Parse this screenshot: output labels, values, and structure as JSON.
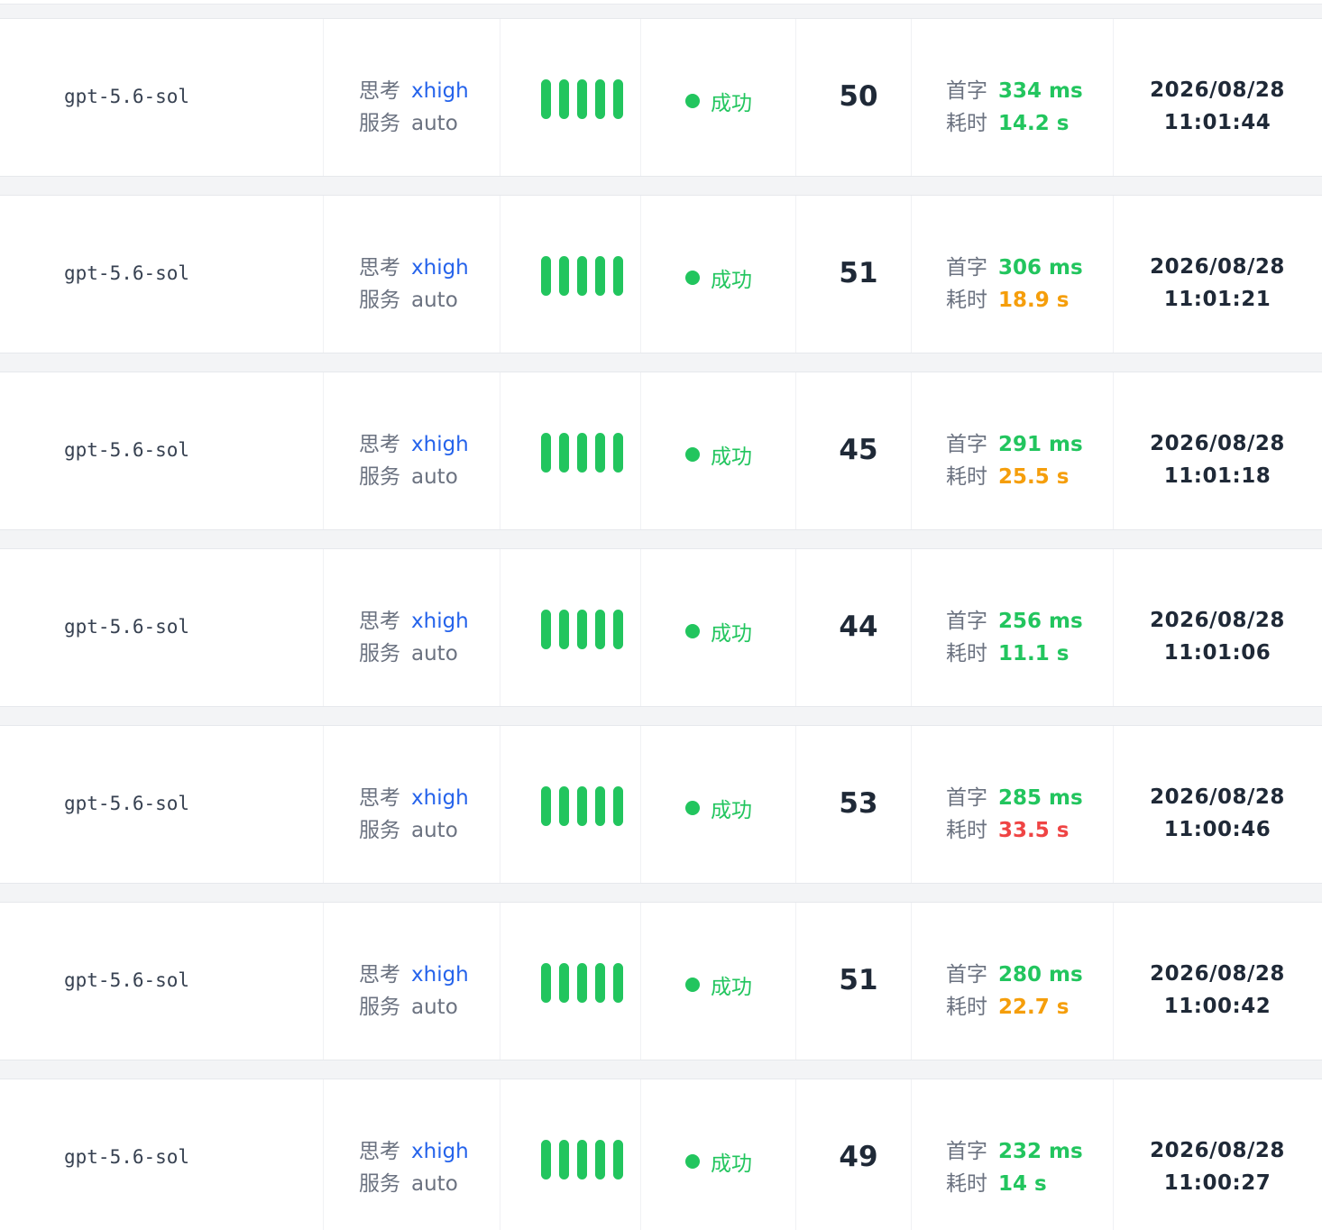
{
  "labels": {
    "think": "思考",
    "service": "服务",
    "first_token": "首字",
    "duration": "耗时"
  },
  "colors": {
    "green": "#22c55e",
    "orange": "#f59e0b",
    "red": "#ef4444",
    "blue": "#2563eb"
  },
  "rows": [
    {
      "model": "gpt-5.6-sol",
      "think": "xhigh",
      "service": "auto",
      "status": "成功",
      "score": "50",
      "first_token": "334 ms",
      "first_token_color": "green",
      "duration": "14.2 s",
      "duration_color": "green",
      "date": "2026/08/28",
      "time": "11:01:44"
    },
    {
      "model": "gpt-5.6-sol",
      "think": "xhigh",
      "service": "auto",
      "status": "成功",
      "score": "51",
      "first_token": "306 ms",
      "first_token_color": "green",
      "duration": "18.9 s",
      "duration_color": "orange",
      "date": "2026/08/28",
      "time": "11:01:21"
    },
    {
      "model": "gpt-5.6-sol",
      "think": "xhigh",
      "service": "auto",
      "status": "成功",
      "score": "45",
      "first_token": "291 ms",
      "first_token_color": "green",
      "duration": "25.5 s",
      "duration_color": "orange",
      "date": "2026/08/28",
      "time": "11:01:18"
    },
    {
      "model": "gpt-5.6-sol",
      "think": "xhigh",
      "service": "auto",
      "status": "成功",
      "score": "44",
      "first_token": "256 ms",
      "first_token_color": "green",
      "duration": "11.1 s",
      "duration_color": "green",
      "date": "2026/08/28",
      "time": "11:01:06"
    },
    {
      "model": "gpt-5.6-sol",
      "think": "xhigh",
      "service": "auto",
      "status": "成功",
      "score": "53",
      "first_token": "285 ms",
      "first_token_color": "green",
      "duration": "33.5 s",
      "duration_color": "red",
      "date": "2026/08/28",
      "time": "11:00:46"
    },
    {
      "model": "gpt-5.6-sol",
      "think": "xhigh",
      "service": "auto",
      "status": "成功",
      "score": "51",
      "first_token": "280 ms",
      "first_token_color": "green",
      "duration": "22.7 s",
      "duration_color": "orange",
      "date": "2026/08/28",
      "time": "11:00:42"
    },
    {
      "model": "gpt-5.6-sol",
      "think": "xhigh",
      "service": "auto",
      "status": "成功",
      "score": "49",
      "first_token": "232 ms",
      "first_token_color": "green",
      "duration": "14 s",
      "duration_color": "green",
      "date": "2026/08/28",
      "time": "11:00:27"
    }
  ]
}
